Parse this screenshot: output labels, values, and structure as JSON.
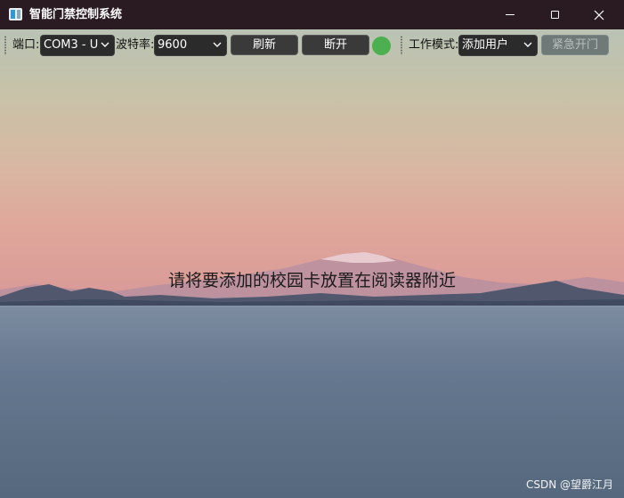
{
  "window": {
    "title": "智能门禁控制系统"
  },
  "toolbar": {
    "port_label": "端口:",
    "port_value": "COM3 - U",
    "baud_label": "波特率:",
    "baud_value": "9600",
    "refresh_label": "刷新",
    "disconnect_label": "断开",
    "connection_status_color": "#4caf50",
    "mode_label": "工作模式:",
    "mode_value": "添加用户",
    "emergency_open_label": "紧急开门"
  },
  "main": {
    "prompt": "请将要添加的校园卡放置在阅读器附近"
  },
  "watermark": {
    "text": "CSDN @望爵江月"
  },
  "icons": {
    "app": "app-icon",
    "minimize": "minimize-icon",
    "maximize": "maximize-icon",
    "close": "close-icon",
    "dropdown": "chevron-down-icon"
  }
}
